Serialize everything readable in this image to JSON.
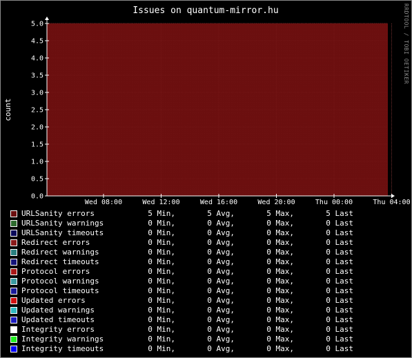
{
  "chart_data": {
    "type": "area",
    "title": "Issues on quantum-mirror.hu",
    "ylabel": "count",
    "watermark": "RRDTOOL / TOBI OETIKER",
    "ylim": [
      0,
      5
    ],
    "y_ticks": [
      "0.0",
      "0.5",
      "1.0",
      "1.5",
      "2.0",
      "2.5",
      "3.0",
      "3.5",
      "4.0",
      "4.5",
      "5.0"
    ],
    "x_ticks": [
      "Wed 08:00",
      "Wed 12:00",
      "Wed 16:00",
      "Wed 20:00",
      "Thu 00:00",
      "Thu 04:00"
    ],
    "grid": true,
    "legend_placement": "bottom",
    "plot_background": "#6b0f0f",
    "grid_color": "#a33a3a",
    "series": [
      {
        "name": "URLSanity errors",
        "color": "#6b0f0f",
        "min": 5,
        "avg": 5,
        "max": 5,
        "last": 5
      },
      {
        "name": "URLSanity warnings",
        "color": "#2e6b2e",
        "min": 0,
        "avg": 0,
        "max": 0,
        "last": 0
      },
      {
        "name": "URLSanity timeouts",
        "color": "#0a0a5a",
        "min": 0,
        "avg": 0,
        "max": 0,
        "last": 0
      },
      {
        "name": "Redirect errors",
        "color": "#8a1a1a",
        "min": 0,
        "avg": 0,
        "max": 0,
        "last": 0
      },
      {
        "name": "Redirect warnings",
        "color": "#2a8080",
        "min": 0,
        "avg": 0,
        "max": 0,
        "last": 0
      },
      {
        "name": "Redirect timeouts",
        "color": "#14147a",
        "min": 0,
        "avg": 0,
        "max": 0,
        "last": 0
      },
      {
        "name": "Protocol errors",
        "color": "#a81818",
        "min": 0,
        "avg": 0,
        "max": 0,
        "last": 0
      },
      {
        "name": "Protocol warnings",
        "color": "#3a9aa0",
        "min": 0,
        "avg": 0,
        "max": 0,
        "last": 0
      },
      {
        "name": "Protocol timeouts",
        "color": "#1a1a9a",
        "min": 0,
        "avg": 0,
        "max": 0,
        "last": 0
      },
      {
        "name": "Updated errors",
        "color": "#d01010",
        "min": 0,
        "avg": 0,
        "max": 0,
        "last": 0
      },
      {
        "name": "Updated warnings",
        "color": "#30b8c0",
        "min": 0,
        "avg": 0,
        "max": 0,
        "last": 0
      },
      {
        "name": "Updated timeouts",
        "color": "#1c1cc0",
        "min": 0,
        "avg": 0,
        "max": 0,
        "last": 0
      },
      {
        "name": "Integrity errors",
        "color": "#ffffff",
        "min": 0,
        "avg": 0,
        "max": 0,
        "last": 0
      },
      {
        "name": "Integrity warnings",
        "color": "#22ee22",
        "min": 0,
        "avg": 0,
        "max": 0,
        "last": 0
      },
      {
        "name": "Integrity timeouts",
        "color": "#0000ff",
        "min": 0,
        "avg": 0,
        "max": 0,
        "last": 0
      }
    ],
    "stat_labels": {
      "min": "Min,",
      "avg": "Avg,",
      "max": "Max,",
      "last": "Last"
    }
  }
}
